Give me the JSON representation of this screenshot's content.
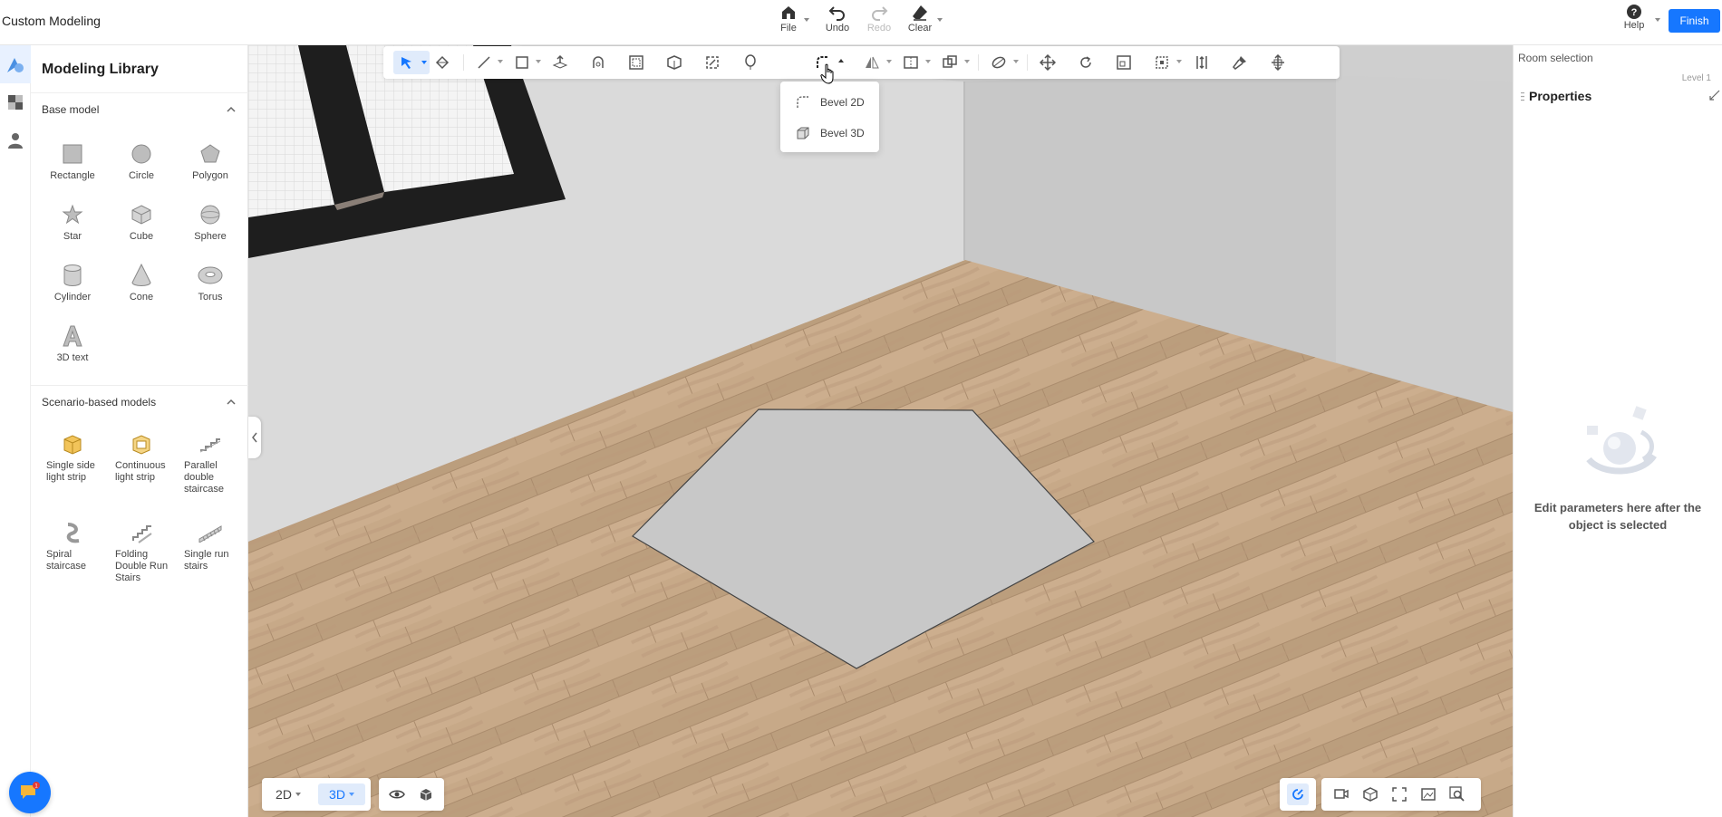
{
  "app": {
    "title": "Custom Modeling"
  },
  "header": {
    "file_label": "File",
    "undo_label": "Undo",
    "redo_label": "Redo",
    "clear_label": "Clear",
    "help_label": "Help",
    "finish_label": "Finish"
  },
  "library": {
    "title": "Modeling Library",
    "base_section": "Base model",
    "base_items": [
      "Rectangle",
      "Circle",
      "Polygon",
      "Star",
      "Cube",
      "Sphere",
      "Cylinder",
      "Cone",
      "Torus",
      "3D text"
    ],
    "scenario_section": "Scenario-based models",
    "scenario_items": [
      [
        "Single side",
        "light strip"
      ],
      [
        "Continuous",
        "light strip"
      ],
      [
        "Parallel",
        "double",
        "staircase"
      ],
      [
        "Spiral",
        "staircase"
      ],
      [
        "Folding",
        "Double Run",
        "Stairs"
      ],
      [
        "Single run",
        "stairs"
      ]
    ]
  },
  "dropdown": {
    "items": [
      "Bevel 2D",
      "Bevel 3D"
    ]
  },
  "view": {
    "mode_2d": "2D",
    "mode_3d": "3D"
  },
  "right_panel": {
    "room_selection": "Room selection",
    "level": "Level 1",
    "properties_title": "Properties",
    "empty_text": "Edit parameters here after the object is selected"
  },
  "colors": {
    "accent": "#1677ff",
    "active_bg": "#e0ebfb",
    "floor": "#c8a98a",
    "wall": "#d3d3d3"
  },
  "chat": {
    "badge": "1"
  }
}
